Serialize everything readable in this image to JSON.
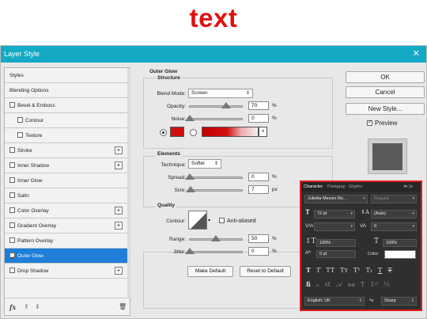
{
  "headline": "text",
  "window": {
    "title": "Layer Style",
    "close": "✕"
  },
  "left_items": [
    {
      "label": "Styles",
      "checkbox": false,
      "plus": false,
      "sub": false,
      "selected": false
    },
    {
      "label": "Blending Options",
      "checkbox": false,
      "plus": false,
      "sub": false,
      "selected": false
    },
    {
      "label": "Bevel & Emboss",
      "checkbox": true,
      "checked": false,
      "plus": false,
      "sub": false,
      "selected": false
    },
    {
      "label": "Contour",
      "checkbox": true,
      "checked": false,
      "plus": false,
      "sub": true,
      "selected": false
    },
    {
      "label": "Texture",
      "checkbox": true,
      "checked": false,
      "plus": false,
      "sub": true,
      "selected": false
    },
    {
      "label": "Stroke",
      "checkbox": true,
      "checked": false,
      "plus": true,
      "sub": false,
      "selected": false
    },
    {
      "label": "Inner Shadow",
      "checkbox": true,
      "checked": false,
      "plus": true,
      "sub": false,
      "selected": false
    },
    {
      "label": "Inner Glow",
      "checkbox": true,
      "checked": false,
      "plus": false,
      "sub": false,
      "selected": false
    },
    {
      "label": "Satin",
      "checkbox": true,
      "checked": false,
      "plus": false,
      "sub": false,
      "selected": false
    },
    {
      "label": "Color Overlay",
      "checkbox": true,
      "checked": false,
      "plus": true,
      "sub": false,
      "selected": false
    },
    {
      "label": "Gradient Overlay",
      "checkbox": true,
      "checked": false,
      "plus": true,
      "sub": false,
      "selected": false
    },
    {
      "label": "Pattern Overlay",
      "checkbox": true,
      "checked": false,
      "plus": false,
      "sub": false,
      "selected": false
    },
    {
      "label": "Outer Glow",
      "checkbox": true,
      "checked": true,
      "plus": false,
      "sub": false,
      "selected": true
    },
    {
      "label": "Drop Shadow",
      "checkbox": true,
      "checked": false,
      "plus": true,
      "sub": false,
      "selected": false
    }
  ],
  "left_footer": {
    "fx": "fx",
    "up": "⬆",
    "down": "⬇",
    "trash": "🗑"
  },
  "outer_glow": {
    "title": "Outer Glow",
    "structure": "Structure",
    "blend_mode_label": "Blend Mode:",
    "blend_mode": "Screen",
    "opacity_label": "Opacity:",
    "opacity": "70",
    "noise_label": "Noise:",
    "noise": "0",
    "percent": "%",
    "color": "#d01010",
    "elements": "Elements",
    "technique_label": "Technique:",
    "technique": "Softer",
    "spread_label": "Spread:",
    "spread": "0",
    "size_label": "Size:",
    "size": "7",
    "px": "px",
    "quality": "Quality",
    "contour_label": "Contour:",
    "anti_aliased": "Anti-aliased",
    "range_label": "Range:",
    "range": "50",
    "jitter_label": "Jitter:",
    "jitter": "0",
    "make_default": "Make Default",
    "reset_default": "Reset to Default"
  },
  "right": {
    "ok": "OK",
    "cancel": "Cancel",
    "new_style": "New Style...",
    "preview": "Preview"
  },
  "character": {
    "tab_character": "Character",
    "tab_paragraph": "Paragrap",
    "tab_glyphs": "Glyphs",
    "menu": "≫ |≡",
    "font": "Julietta Messie Re...",
    "style": "Regular",
    "size": "72 pt",
    "leading": "(Auto)",
    "tracking": "0",
    "vscale": "100%",
    "hscale": "100%",
    "baseline": "0 pt",
    "color_label": "Color:",
    "language": "English: UK",
    "aa_label": "ªa",
    "aa": "Sharp"
  }
}
